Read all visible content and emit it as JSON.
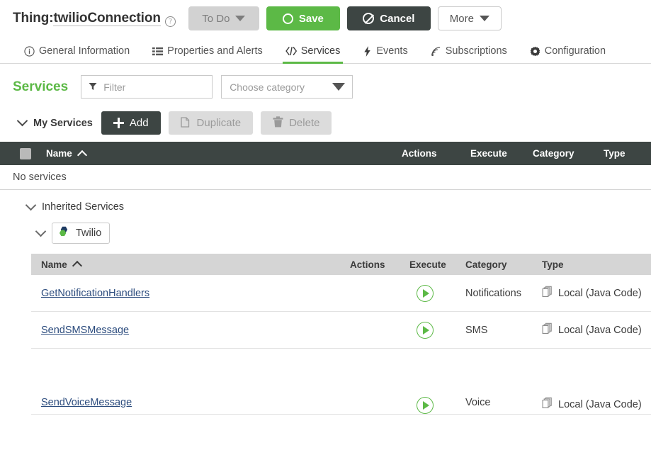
{
  "header": {
    "title_prefix": "Thing:",
    "title_name": "twilioConnection",
    "help_icon": "help-circle-icon",
    "todo_label": "To Do",
    "save_label": "Save",
    "cancel_label": "Cancel",
    "more_label": "More"
  },
  "tabs": [
    {
      "label": "General Information",
      "icon": "info-circle-icon",
      "active": false
    },
    {
      "label": "Properties and Alerts",
      "icon": "list-icon",
      "active": false
    },
    {
      "label": "Services",
      "icon": "code-brackets-icon",
      "active": true
    },
    {
      "label": "Events",
      "icon": "lightning-bolt-icon",
      "active": false
    },
    {
      "label": "Subscriptions",
      "icon": "rss-signal-icon",
      "active": false
    },
    {
      "label": "Configuration",
      "icon": "gear-icon",
      "active": false
    }
  ],
  "services_bar": {
    "title": "Services",
    "filter_placeholder": "Filter",
    "filter_value": "",
    "filter_icon": "funnel-icon",
    "category_placeholder": "Choose category",
    "category_value": "",
    "category_caret": "chevron-down-icon"
  },
  "toolbar": {
    "my_services_label": "My Services",
    "add_label": "Add",
    "duplicate_label": "Duplicate",
    "delete_label": "Delete",
    "add_icon": "plus-icon",
    "duplicate_icon": "copy-icon",
    "delete_icon": "trash-icon"
  },
  "my_services_table": {
    "columns": {
      "name": "Name",
      "actions": "Actions",
      "execute": "Execute",
      "category": "Category",
      "type": "Type"
    },
    "sort_indicator": "chevron-up-icon",
    "empty_message": "No services"
  },
  "inherited": {
    "label": "Inherited Services",
    "entity_label": "Twilio",
    "entity_icon": "twilio-hexagon-icon",
    "columns": {
      "name": "Name",
      "actions": "Actions",
      "execute": "Execute",
      "category": "Category",
      "type": "Type"
    },
    "sort_indicator": "chevron-up-icon",
    "rows": [
      {
        "name": "GetNotificationHandlers",
        "execute_icon": "play-circle-icon",
        "category": "Notifications",
        "type": "Local (Java Code)",
        "type_icon": "stacked-pages-icon"
      },
      {
        "name": "SendSMSMessage",
        "execute_icon": "play-circle-icon",
        "category": "SMS",
        "type": "Local (Java Code)",
        "type_icon": "stacked-pages-icon"
      },
      {
        "name": "SendVoiceMessage",
        "execute_icon": "play-circle-icon",
        "category": "Voice",
        "type": "Local (Java Code)",
        "type_icon": "stacked-pages-icon"
      }
    ]
  },
  "colors": {
    "accent_green": "#5cb946",
    "dark_header": "#3d4543",
    "disabled_gray": "#dcdcdc",
    "link_blue": "#2b4b7d"
  }
}
